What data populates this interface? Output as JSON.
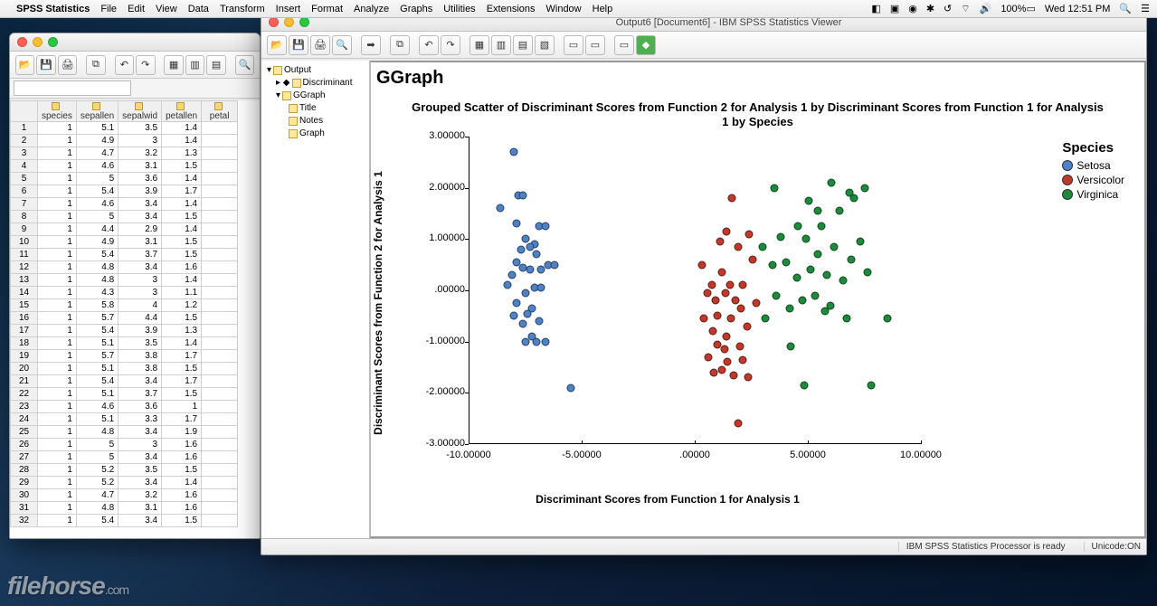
{
  "menubar": {
    "app": "SPSS Statistics",
    "items": [
      "File",
      "Edit",
      "View",
      "Data",
      "Transform",
      "Insert",
      "Format",
      "Analyze",
      "Graphs",
      "Utilities",
      "Extensions",
      "Window",
      "Help"
    ],
    "battery": "100%",
    "clock": "Wed 12:51 PM"
  },
  "data_editor": {
    "columns": [
      "species",
      "sepallen",
      "sepalwid",
      "petallen",
      "petal"
    ],
    "rows": [
      [
        1,
        5.1,
        3.5,
        1.4
      ],
      [
        1,
        4.9,
        3.0,
        1.4
      ],
      [
        1,
        4.7,
        3.2,
        1.3
      ],
      [
        1,
        4.6,
        3.1,
        1.5
      ],
      [
        1,
        5.0,
        3.6,
        1.4
      ],
      [
        1,
        5.4,
        3.9,
        1.7
      ],
      [
        1,
        4.6,
        3.4,
        1.4
      ],
      [
        1,
        5.0,
        3.4,
        1.5
      ],
      [
        1,
        4.4,
        2.9,
        1.4
      ],
      [
        1,
        4.9,
        3.1,
        1.5
      ],
      [
        1,
        5.4,
        3.7,
        1.5
      ],
      [
        1,
        4.8,
        3.4,
        1.6
      ],
      [
        1,
        4.8,
        3.0,
        1.4
      ],
      [
        1,
        4.3,
        3.0,
        1.1
      ],
      [
        1,
        5.8,
        4.0,
        1.2
      ],
      [
        1,
        5.7,
        4.4,
        1.5
      ],
      [
        1,
        5.4,
        3.9,
        1.3
      ],
      [
        1,
        5.1,
        3.5,
        1.4
      ],
      [
        1,
        5.7,
        3.8,
        1.7
      ],
      [
        1,
        5.1,
        3.8,
        1.5
      ],
      [
        1,
        5.4,
        3.4,
        1.7
      ],
      [
        1,
        5.1,
        3.7,
        1.5
      ],
      [
        1,
        4.6,
        3.6,
        1.0
      ],
      [
        1,
        5.1,
        3.3,
        1.7
      ],
      [
        1,
        4.8,
        3.4,
        1.9
      ],
      [
        1,
        5.0,
        3.0,
        1.6
      ],
      [
        1,
        5.0,
        3.4,
        1.6
      ],
      [
        1,
        5.2,
        3.5,
        1.5
      ],
      [
        1,
        5.2,
        3.4,
        1.4
      ],
      [
        1,
        4.7,
        3.2,
        1.6
      ],
      [
        1,
        4.8,
        3.1,
        1.6
      ],
      [
        1,
        5.4,
        3.4,
        1.5
      ]
    ]
  },
  "output_viewer": {
    "title": "Output6 [Document6] - IBM SPSS Statistics Viewer",
    "tree": {
      "root": "Output",
      "n1": "Discriminant",
      "n2": "GGraph",
      "n3": "Title",
      "n4": "Notes",
      "n5": "Graph"
    },
    "heading": "GGraph",
    "status_processor": "IBM SPSS Statistics Processor is ready",
    "status_unicode": "Unicode:ON"
  },
  "chart_data": {
    "type": "scatter",
    "title": "Grouped Scatter of Discriminant Scores from Function 2 for Analysis 1 by Discriminant Scores from Function 1 for Analysis 1 by Species",
    "xlabel": "Discriminant Scores from Function 1 for Analysis 1",
    "ylabel": "Discriminant Scores from Function 2 for Analysis 1",
    "xlim": [
      -10,
      10
    ],
    "ylim": [
      -3,
      3
    ],
    "xticks": [
      "-10.00000",
      "-5.00000",
      ".00000",
      "5.00000",
      "10.00000"
    ],
    "yticks": [
      "-3.00000",
      "-2.00000",
      "-1.00000",
      ".00000",
      "1.00000",
      "2.00000",
      "3.00000"
    ],
    "legend_title": "Species",
    "series": [
      {
        "name": "Setosa",
        "color": "#4f81c7",
        "points": [
          [
            -8.0,
            2.7
          ],
          [
            -8.6,
            1.6
          ],
          [
            -7.8,
            1.85
          ],
          [
            -7.6,
            1.85
          ],
          [
            -7.9,
            1.3
          ],
          [
            -6.9,
            1.25
          ],
          [
            -6.6,
            1.25
          ],
          [
            -7.5,
            1.0
          ],
          [
            -7.1,
            0.9
          ],
          [
            -7.3,
            0.85
          ],
          [
            -7.7,
            0.8
          ],
          [
            -7.0,
            0.7
          ],
          [
            -7.9,
            0.55
          ],
          [
            -6.5,
            0.5
          ],
          [
            -6.2,
            0.5
          ],
          [
            -6.8,
            0.4
          ],
          [
            -7.3,
            0.4
          ],
          [
            -7.6,
            0.45
          ],
          [
            -8.1,
            0.3
          ],
          [
            -8.3,
            0.1
          ],
          [
            -7.1,
            0.05
          ],
          [
            -6.8,
            0.05
          ],
          [
            -7.5,
            -0.05
          ],
          [
            -7.9,
            -0.25
          ],
          [
            -7.2,
            -0.35
          ],
          [
            -7.4,
            -0.45
          ],
          [
            -8.0,
            -0.5
          ],
          [
            -7.6,
            -0.65
          ],
          [
            -6.9,
            -0.6
          ],
          [
            -7.2,
            -0.9
          ],
          [
            -7.0,
            -1.0
          ],
          [
            -7.5,
            -1.0
          ],
          [
            -6.6,
            -1.0
          ],
          [
            -5.5,
            -1.9
          ]
        ]
      },
      {
        "name": "Versicolor",
        "color": "#c0392b",
        "points": [
          [
            1.65,
            1.8
          ],
          [
            1.4,
            1.15
          ],
          [
            2.4,
            1.1
          ],
          [
            1.1,
            0.95
          ],
          [
            1.9,
            0.85
          ],
          [
            2.55,
            0.6
          ],
          [
            0.3,
            0.5
          ],
          [
            1.2,
            0.35
          ],
          [
            0.75,
            0.1
          ],
          [
            1.55,
            0.1
          ],
          [
            2.1,
            0.1
          ],
          [
            0.55,
            -0.05
          ],
          [
            1.35,
            -0.05
          ],
          [
            0.9,
            -0.2
          ],
          [
            1.8,
            -0.2
          ],
          [
            2.7,
            -0.25
          ],
          [
            2.05,
            -0.35
          ],
          [
            0.4,
            -0.55
          ],
          [
            1.0,
            -0.5
          ],
          [
            1.6,
            -0.55
          ],
          [
            2.3,
            -0.7
          ],
          [
            0.8,
            -0.8
          ],
          [
            1.4,
            -0.9
          ],
          [
            1.0,
            -1.05
          ],
          [
            2.0,
            -1.1
          ],
          [
            0.6,
            -1.3
          ],
          [
            1.45,
            -1.4
          ],
          [
            2.1,
            -1.35
          ],
          [
            1.2,
            -1.55
          ],
          [
            0.85,
            -1.6
          ],
          [
            1.7,
            -1.65
          ],
          [
            2.35,
            -1.7
          ],
          [
            1.9,
            -2.6
          ],
          [
            1.3,
            -1.15
          ]
        ]
      },
      {
        "name": "Virginica",
        "color": "#1e8a3b",
        "points": [
          [
            3.0,
            0.85
          ],
          [
            3.45,
            0.5
          ],
          [
            3.8,
            1.05
          ],
          [
            3.6,
            -0.1
          ],
          [
            4.05,
            0.55
          ],
          [
            4.2,
            -0.35
          ],
          [
            3.1,
            -0.55
          ],
          [
            4.5,
            0.25
          ],
          [
            4.75,
            -0.2
          ],
          [
            4.9,
            1.0
          ],
          [
            5.1,
            0.4
          ],
          [
            5.45,
            0.7
          ],
          [
            5.3,
            -0.1
          ],
          [
            5.6,
            1.25
          ],
          [
            5.85,
            0.3
          ],
          [
            6.0,
            -0.3
          ],
          [
            6.15,
            0.85
          ],
          [
            6.4,
            1.55
          ],
          [
            6.55,
            0.2
          ],
          [
            6.7,
            -0.55
          ],
          [
            6.9,
            0.6
          ],
          [
            7.05,
            1.8
          ],
          [
            7.3,
            0.95
          ],
          [
            7.5,
            2.0
          ],
          [
            7.65,
            0.35
          ],
          [
            7.8,
            -1.85
          ],
          [
            4.25,
            -1.1
          ],
          [
            4.85,
            -1.85
          ],
          [
            3.5,
            2.0
          ],
          [
            6.05,
            2.1
          ],
          [
            6.85,
            1.9
          ],
          [
            5.05,
            1.75
          ],
          [
            5.45,
            1.55
          ],
          [
            4.55,
            1.25
          ],
          [
            8.5,
            -0.55
          ],
          [
            5.75,
            -0.4
          ]
        ]
      }
    ]
  },
  "watermark": "filehorse",
  "watermark_suffix": ".com"
}
